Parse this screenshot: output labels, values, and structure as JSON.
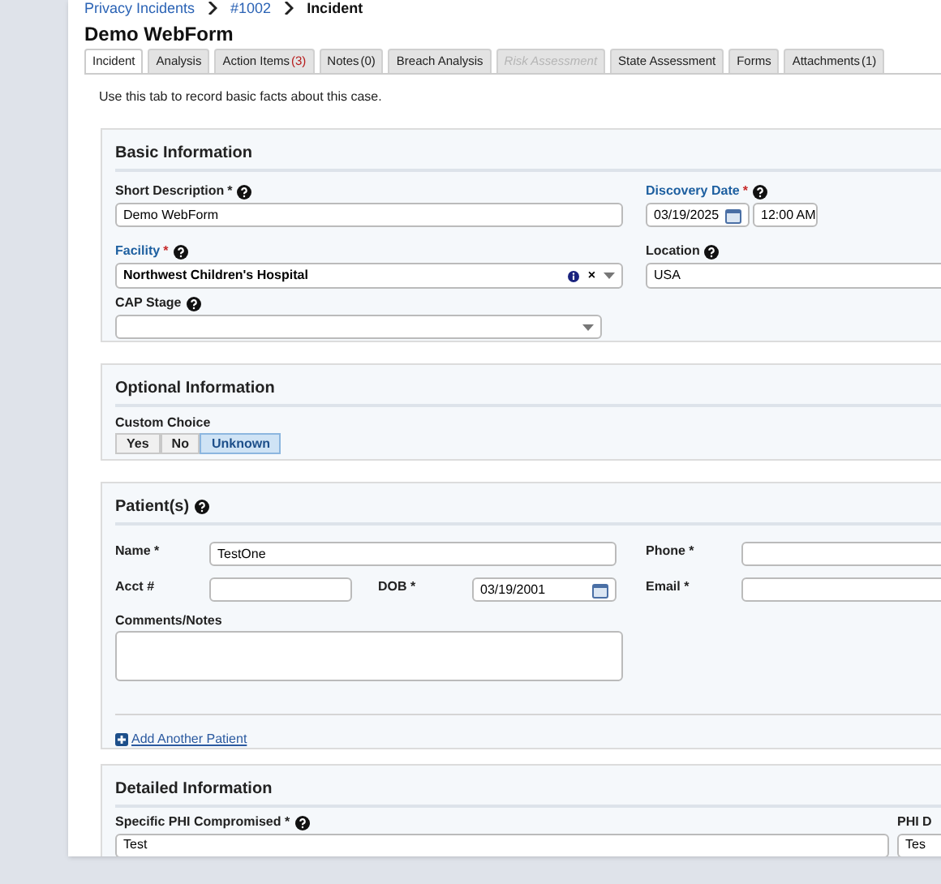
{
  "breadcrumb": [
    {
      "label": "Privacy Incidents",
      "link": true
    },
    {
      "label": "#1002",
      "link": true
    },
    {
      "label": "Incident",
      "link": false
    }
  ],
  "title": "Demo WebForm",
  "tabs": [
    {
      "label": "Incident",
      "selected": true,
      "disabled": false
    },
    {
      "label": "Analysis",
      "selected": false,
      "disabled": false
    },
    {
      "label": "Action Items",
      "count": "(3)",
      "alert": true,
      "selected": false,
      "disabled": false
    },
    {
      "label": "Notes",
      "count": "(0)",
      "alert": false,
      "selected": false,
      "disabled": false
    },
    {
      "label": "Breach Analysis",
      "selected": false,
      "disabled": false
    },
    {
      "label": "Risk Assessment",
      "selected": false,
      "disabled": true
    },
    {
      "label": "State Assessment",
      "selected": false,
      "disabled": false
    },
    {
      "label": "Forms",
      "selected": false,
      "disabled": false
    },
    {
      "label": "Attachments",
      "count": "(1)",
      "alert": false,
      "selected": false,
      "disabled": false
    }
  ],
  "hint": "Use this tab to record basic facts about this case.",
  "basic": {
    "heading": "Basic Information",
    "short_description": {
      "label": "Short Description",
      "required_mark": "*",
      "value": "Demo WebForm"
    },
    "discovery_date": {
      "label": "Discovery Date",
      "required_mark": "*",
      "date": "03/19/2025",
      "time": "12:00 AM"
    },
    "facility": {
      "label": "Facility",
      "required_mark": "*",
      "value": "Northwest Children's Hospital",
      "clear": "×"
    },
    "location": {
      "label": "Location",
      "value": "USA"
    },
    "cap_stage": {
      "label": "CAP Stage"
    }
  },
  "optional": {
    "heading": "Optional Information",
    "custom_choice": {
      "label": "Custom Choice",
      "options": [
        {
          "label": "Yes",
          "selected": false
        },
        {
          "label": "No",
          "selected": false
        },
        {
          "label": "Unknown",
          "selected": true
        }
      ]
    }
  },
  "patients": {
    "heading": "Patient(s)",
    "name": {
      "label": "Name *",
      "value": "TestOne"
    },
    "phone": {
      "label": "Phone *"
    },
    "acct": {
      "label": "Acct #"
    },
    "dob": {
      "label": "DOB *",
      "value": "03/19/2001"
    },
    "email": {
      "label": "Email *"
    },
    "comments": {
      "label": "Comments/Notes"
    },
    "add_link": "Add Another Patient"
  },
  "detailed": {
    "heading": "Detailed Information",
    "phi_compromised": {
      "label": "Specific PHI Compromised *",
      "value": "Test"
    },
    "column_2": {
      "label": "PHI D",
      "value": "Tes"
    }
  }
}
